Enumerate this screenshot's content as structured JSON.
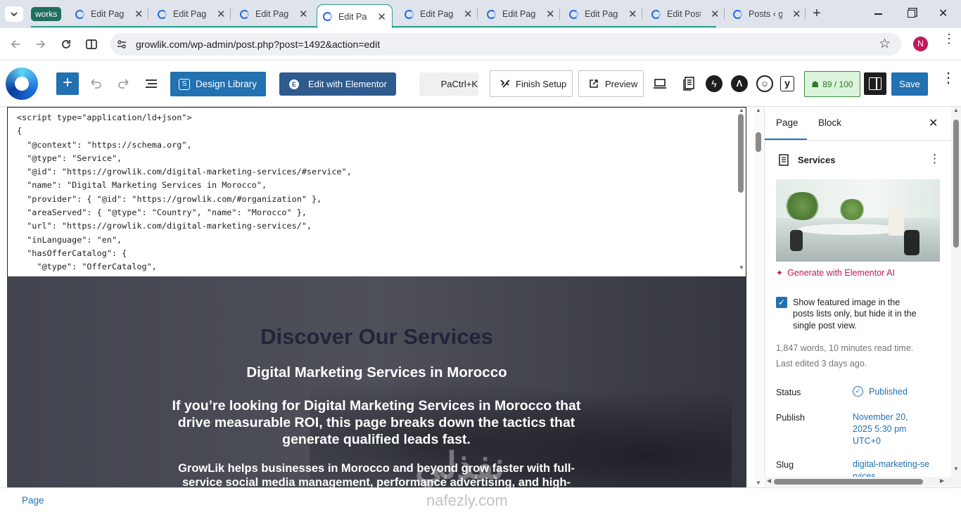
{
  "browser": {
    "tab_group": "works",
    "tabs": [
      {
        "title": "Edit Page"
      },
      {
        "title": "Edit Page"
      },
      {
        "title": "Edit Page"
      },
      {
        "title": "Edit Page"
      },
      {
        "title": "Edit Page"
      },
      {
        "title": "Edit Page"
      },
      {
        "title": "Edit Page"
      },
      {
        "title": "Edit Post"
      },
      {
        "title": "Posts ‹ g"
      }
    ],
    "url": "growlik.com/wp-admin/post.php?post=1492&action=edit",
    "profile_initial": "N"
  },
  "editor_toolbar": {
    "design_library": "Design Library",
    "edit_with_elementor": "Edit with Elementor",
    "command_hint": "PaCtrl+K",
    "finish_setup": "Finish Setup",
    "preview": "Preview",
    "seo_score": "89 / 100",
    "save": "Save",
    "accent": "#2271b1"
  },
  "code_block": {
    "lines": [
      "<script type=\"application/ld+json\">",
      "{",
      "  \"@context\": \"https://schema.org\",",
      "  \"@type\": \"Service\",",
      "  \"@id\": \"https://growlik.com/digital-marketing-services/#service\",",
      "  \"name\": \"Digital Marketing Services in Morocco\",",
      "  \"provider\": { \"@id\": \"https://growlik.com/#organization\" },",
      "  \"areaServed\": { \"@type\": \"Country\", \"name\": \"Morocco\" },",
      "  \"url\": \"https://growlik.com/digital-marketing-services/\",",
      "  \"inLanguage\": \"en\",",
      "  \"hasOfferCatalog\": {",
      "    \"@type\": \"OfferCatalog\","
    ]
  },
  "hero": {
    "heading": "Discover Our Services",
    "subheading": "Digital Marketing Services in Morocco",
    "lead": "If you’re looking for Digital Marketing Services in Morocco that drive measurable ROI, this page breaks down the tactics that generate qualified leads fast.",
    "body": "GrowLik helps businesses in Morocco and beyond grow faster with full-service social media management, performance advertising, and high-"
  },
  "sidebar": {
    "tabs": [
      "Page",
      "Block"
    ],
    "page_title": "Services",
    "generate_ai": "Generate with Elementor AI",
    "featured_checkbox_label": "Show featured image in the posts lists only, but hide it in the single post view.",
    "featured_checked": true,
    "stats": "1,847 words, 10 minutes read time.",
    "last_edited": "Last edited 3 days ago.",
    "status_label": "Status",
    "status_value": "Published",
    "publish_label": "Publish",
    "publish_value": "November 20, 2025 5:30 pm UTC+0",
    "slug_label": "Slug",
    "slug_value": "digital-marketing-services"
  },
  "footer": {
    "breadcrumb": "Page"
  },
  "watermark": {
    "arabic": "نفذلي",
    "latin": "nafezly.com"
  }
}
